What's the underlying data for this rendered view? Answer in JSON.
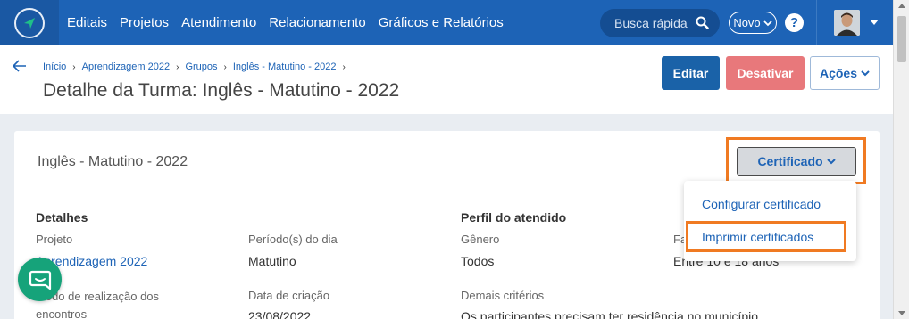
{
  "nav": {
    "links": [
      "Editais",
      "Projetos",
      "Atendimento",
      "Relacionamento",
      "Gráficos e Relatórios"
    ],
    "search_placeholder": "Busca rápida",
    "novo_label": "Novo",
    "help_label": "?"
  },
  "header": {
    "breadcrumb": [
      "Início",
      "Aprendizagem 2022",
      "Grupos",
      "Inglês - Matutino - 2022"
    ],
    "title": "Detalhe da Turma: Inglês - Matutino - 2022",
    "edit_label": "Editar",
    "deactivate_label": "Desativar",
    "actions_label": "Ações"
  },
  "card": {
    "title": "Inglês - Matutino - 2022",
    "certificate_label": "Certificado",
    "dropdown": [
      "Configurar certificado",
      "Imprimir certificados"
    ],
    "details": {
      "heading": "Detalhes",
      "project_label": "Projeto",
      "project_value": "Aprendizagem 2022",
      "periods_label": "Período(s) do dia",
      "periods_value": "Matutino",
      "method_label": "...odo de realização dos encontros",
      "created_label": "Data de criação",
      "created_value": "23/08/2022"
    },
    "profile": {
      "heading": "Perfil do atendido",
      "gender_label": "Gênero",
      "gender_value": "Todos",
      "age_label": "Fa",
      "age_value": "Entre 10 e 18 anos",
      "other_label": "Demais critérios",
      "other_value": "Os participantes precisam ter residência no município"
    }
  },
  "colors": {
    "primary": "#1d63b6",
    "danger": "#e8787b",
    "highlight": "#f07a22",
    "chat": "#16a37a"
  }
}
